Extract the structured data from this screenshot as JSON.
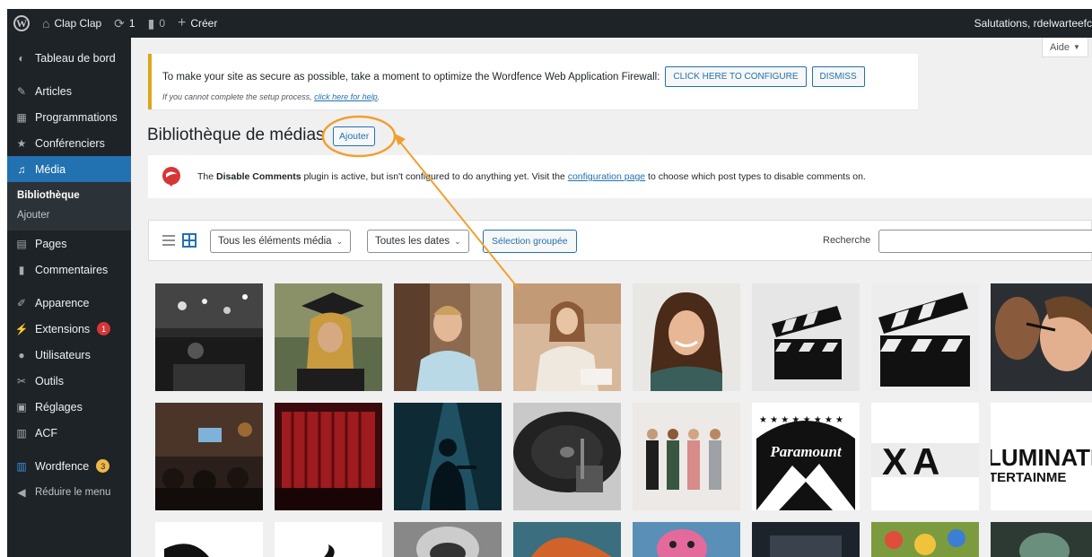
{
  "adminbar": {
    "site_name": "Clap Clap",
    "updates_count": "1",
    "comments_count": "0",
    "new_label": "Créer",
    "greeting": "Salutations, rdelwarteefc"
  },
  "sidebar": {
    "items": [
      {
        "label": "Tableau de bord",
        "icon": "dashboard-icon"
      },
      {
        "label": "Articles",
        "icon": "pin-icon"
      },
      {
        "label": "Programmations",
        "icon": "calendar-icon"
      },
      {
        "label": "Conférenciers",
        "icon": "star-icon"
      },
      {
        "label": "Média",
        "icon": "media-icon"
      },
      {
        "label": "Pages",
        "icon": "page-icon"
      },
      {
        "label": "Commentaires",
        "icon": "comment-icon"
      },
      {
        "label": "Apparence",
        "icon": "brush-icon"
      },
      {
        "label": "Extensions",
        "icon": "plugin-icon",
        "badge": "1"
      },
      {
        "label": "Utilisateurs",
        "icon": "users-icon"
      },
      {
        "label": "Outils",
        "icon": "wrench-icon"
      },
      {
        "label": "Réglages",
        "icon": "settings-icon"
      },
      {
        "label": "ACF",
        "icon": "acf-icon"
      },
      {
        "label": "Wordfence",
        "icon": "wordfence-icon",
        "badge": "3"
      },
      {
        "label": "Réduire le menu",
        "icon": "collapse-icon"
      }
    ],
    "submenu": [
      "Bibliothèque",
      "Ajouter"
    ]
  },
  "help": {
    "label": "Aide"
  },
  "wordfence_notice": {
    "text": "To make your site as secure as possible, take a moment to optimize the Wordfence Web Application Firewall:",
    "configure_label": "CLICK HERE TO CONFIGURE",
    "dismiss_label": "DISMISS",
    "help_prefix": "If you cannot complete the setup process,",
    "help_link": "click here for help",
    "help_suffix": "."
  },
  "page": {
    "title": "Bibliothèque de médias",
    "add_label": "Ajouter"
  },
  "disable_comments_notice": {
    "pre": "The",
    "plugin_name": "Disable Comments",
    "mid": "plugin is active, but isn't configured to do anything yet. Visit the",
    "link": "configuration page",
    "post": "to choose which post types to disable comments on."
  },
  "toolbar": {
    "filter_type": "Tous les éléments média",
    "filter_date": "Toutes les dates",
    "bulk_label": "Sélection groupée",
    "search_label": "Recherche",
    "search_value": ""
  },
  "media_grid": {
    "tiles": [
      {
        "name": "media-tile-concert-bw"
      },
      {
        "name": "media-tile-graduate"
      },
      {
        "name": "media-tile-man-smiling"
      },
      {
        "name": "media-tile-woman-speaking"
      },
      {
        "name": "media-tile-woman-curly-hair"
      },
      {
        "name": "media-tile-clapperboard-1"
      },
      {
        "name": "media-tile-clapperboard-2"
      },
      {
        "name": "media-tile-makeup"
      },
      {
        "name": "media-tile-cinema-audience"
      },
      {
        "name": "media-tile-red-curtain"
      },
      {
        "name": "media-tile-silhouette"
      },
      {
        "name": "media-tile-turntable"
      },
      {
        "name": "media-tile-group-people"
      },
      {
        "name": "media-tile-paramount-logo",
        "text": "Paramount"
      },
      {
        "name": "media-tile-pixar-logo",
        "text": "XA"
      },
      {
        "name": "media-tile-illumination-logo",
        "text1": "LUMINATI",
        "text2": "TERTAINME"
      }
    ]
  }
}
